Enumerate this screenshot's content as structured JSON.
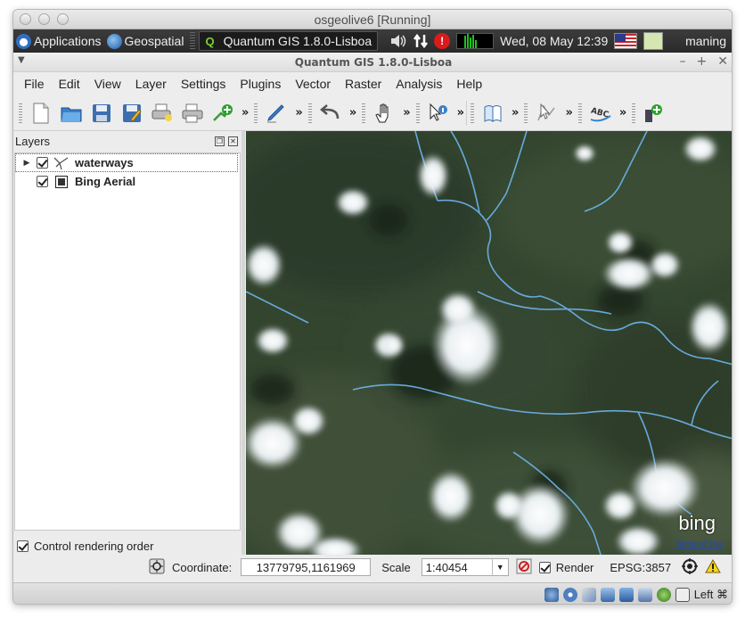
{
  "vm": {
    "title": "osgeolive6 [Running]"
  },
  "panel": {
    "applications": "Applications",
    "geospatial": "Geospatial",
    "task_title": "Quantum GIS 1.8.0-Lisboa",
    "datetime": "Wed, 08 May  12:39",
    "user": "maning"
  },
  "qgis": {
    "title": "Quantum GIS 1.8.0-Lisboa",
    "menu": [
      "File",
      "Edit",
      "View",
      "Layer",
      "Settings",
      "Plugins",
      "Vector",
      "Raster",
      "Analysis",
      "Help"
    ],
    "toolbar_more": "»",
    "layers_panel": {
      "title": "Layers",
      "layers": [
        {
          "name": "waterways",
          "checked": true,
          "icon": "line-layer-icon"
        },
        {
          "name": "Bing Aerial",
          "checked": true,
          "icon": "raster-layer-icon"
        }
      ],
      "control_rendering_order": "Control rendering order"
    },
    "map": {
      "attribution": "bing",
      "terms": "Terms of Use"
    },
    "status": {
      "coordinate_label": "Coordinate:",
      "coordinate_value": "13779795,1161969",
      "scale_label": "Scale",
      "scale_value": "1:40454",
      "render_label": "Render",
      "epsg": "EPSG:3857"
    }
  },
  "vbox": {
    "host_key": "Left ⌘"
  },
  "colors": {
    "water": "#5fa3d9",
    "vegetation": "#30432f",
    "panel": "#2e2e2e"
  }
}
